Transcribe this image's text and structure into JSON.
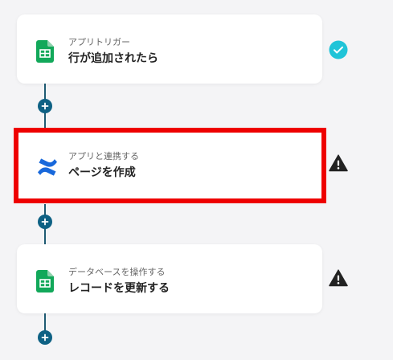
{
  "flow": {
    "steps": [
      {
        "type": "trigger",
        "subtitle": "アプリトリガー",
        "title": "行が追加されたら",
        "app_icon": "google-sheets-icon",
        "status": "check-circle-icon",
        "selected": false
      },
      {
        "type": "app-action",
        "subtitle": "アプリと連携する",
        "title": "ページを作成",
        "app_icon": "confluence-icon",
        "status": "warning-icon",
        "selected": true
      },
      {
        "type": "database-action",
        "subtitle": "データベースを操作する",
        "title": "レコードを更新する",
        "app_icon": "google-sheets-icon",
        "status": "warning-icon",
        "selected": false
      }
    ],
    "add_step_icon": "plus-icon"
  },
  "colors": {
    "background": "#f4f4f6",
    "connector": "#1f5b73",
    "add_button": "#0e6184",
    "selection_border": "#ee0000",
    "status_ok": "#20c4d8",
    "status_warning": "#222222",
    "sheets_green": "#12a85a",
    "confluence_blue": "#1868db"
  }
}
